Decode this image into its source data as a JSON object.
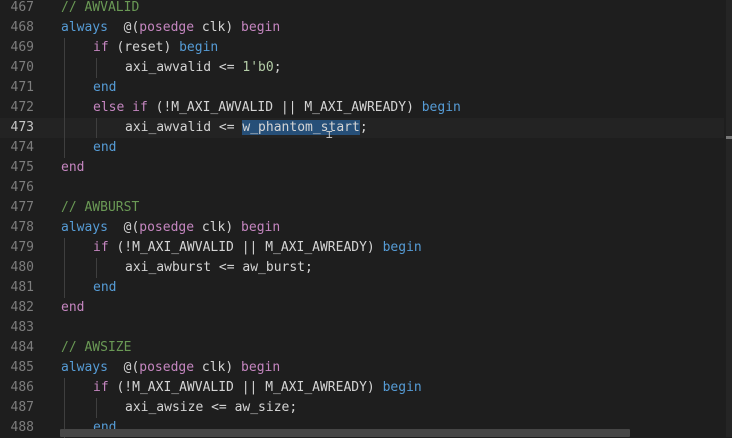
{
  "editor": {
    "active_line": "473",
    "lines": [
      {
        "num": "467",
        "indent": 0,
        "guides": 0,
        "tokens": [
          [
            "cm",
            "// AWVALID"
          ]
        ]
      },
      {
        "num": "468",
        "indent": 0,
        "guides": 0,
        "tokens": [
          [
            "kw",
            "always"
          ],
          [
            "",
            "  @("
          ],
          [
            "ctl",
            "posedge"
          ],
          [
            "",
            " clk) "
          ],
          [
            "ctl",
            "begin"
          ]
        ]
      },
      {
        "num": "469",
        "indent": 1,
        "guides": 1,
        "tokens": [
          [
            "ctl",
            "if"
          ],
          [
            "",
            " (reset) "
          ],
          [
            "kw",
            "begin"
          ]
        ]
      },
      {
        "num": "470",
        "indent": 2,
        "guides": 2,
        "tokens": [
          [
            "",
            "axi_awvalid <= "
          ],
          [
            "num",
            "1'b0"
          ],
          [
            "",
            ";"
          ]
        ]
      },
      {
        "num": "471",
        "indent": 1,
        "guides": 1,
        "tokens": [
          [
            "kw",
            "end"
          ]
        ]
      },
      {
        "num": "472",
        "indent": 1,
        "guides": 1,
        "tokens": [
          [
            "ctl",
            "else"
          ],
          [
            "",
            " "
          ],
          [
            "ctl",
            "if"
          ],
          [
            "",
            " (!M_AXI_AWVALID || M_AXI_AWREADY) "
          ],
          [
            "kw",
            "begin"
          ]
        ]
      },
      {
        "num": "473",
        "indent": 2,
        "guides": 2,
        "tokens": [
          [
            "",
            "axi_awvalid <= "
          ],
          [
            "sel",
            "w_phantom_start"
          ],
          [
            "",
            ";"
          ]
        ]
      },
      {
        "num": "474",
        "indent": 1,
        "guides": 1,
        "tokens": [
          [
            "kw",
            "end"
          ]
        ]
      },
      {
        "num": "475",
        "indent": 0,
        "guides": 0,
        "tokens": [
          [
            "ctl",
            "end"
          ]
        ]
      },
      {
        "num": "476",
        "indent": 0,
        "guides": 0,
        "tokens": []
      },
      {
        "num": "477",
        "indent": 0,
        "guides": 0,
        "tokens": [
          [
            "cm",
            "// AWBURST"
          ]
        ]
      },
      {
        "num": "478",
        "indent": 0,
        "guides": 0,
        "tokens": [
          [
            "kw",
            "always"
          ],
          [
            "",
            "  @("
          ],
          [
            "ctl",
            "posedge"
          ],
          [
            "",
            " clk) "
          ],
          [
            "ctl",
            "begin"
          ]
        ]
      },
      {
        "num": "479",
        "indent": 1,
        "guides": 1,
        "tokens": [
          [
            "ctl",
            "if"
          ],
          [
            "",
            " (!M_AXI_AWVALID || M_AXI_AWREADY) "
          ],
          [
            "kw",
            "begin"
          ]
        ]
      },
      {
        "num": "480",
        "indent": 2,
        "guides": 2,
        "tokens": [
          [
            "",
            "axi_awburst <= aw_burst;"
          ]
        ]
      },
      {
        "num": "481",
        "indent": 1,
        "guides": 1,
        "tokens": [
          [
            "kw",
            "end"
          ]
        ]
      },
      {
        "num": "482",
        "indent": 0,
        "guides": 0,
        "tokens": [
          [
            "ctl",
            "end"
          ]
        ]
      },
      {
        "num": "483",
        "indent": 0,
        "guides": 0,
        "tokens": []
      },
      {
        "num": "484",
        "indent": 0,
        "guides": 0,
        "tokens": [
          [
            "cm",
            "// AWSIZE"
          ]
        ]
      },
      {
        "num": "485",
        "indent": 0,
        "guides": 0,
        "tokens": [
          [
            "kw",
            "always"
          ],
          [
            "",
            "  @("
          ],
          [
            "ctl",
            "posedge"
          ],
          [
            "",
            " clk) "
          ],
          [
            "ctl",
            "begin"
          ]
        ]
      },
      {
        "num": "486",
        "indent": 1,
        "guides": 1,
        "tokens": [
          [
            "ctl",
            "if"
          ],
          [
            "",
            " (!M_AXI_AWVALID || M_AXI_AWREADY) "
          ],
          [
            "kw",
            "begin"
          ]
        ]
      },
      {
        "num": "487",
        "indent": 2,
        "guides": 2,
        "tokens": [
          [
            "",
            "axi_awsize <= aw_size;"
          ]
        ]
      },
      {
        "num": "488",
        "indent": 1,
        "guides": 1,
        "tokens": [
          [
            "kw",
            "end"
          ]
        ]
      }
    ]
  },
  "colors": {
    "background": "#1e1e1e",
    "keyword": "#569cd6",
    "control": "#c586c0",
    "comment": "#6a9955",
    "number": "#b5cea8",
    "selection": "#264f78"
  }
}
